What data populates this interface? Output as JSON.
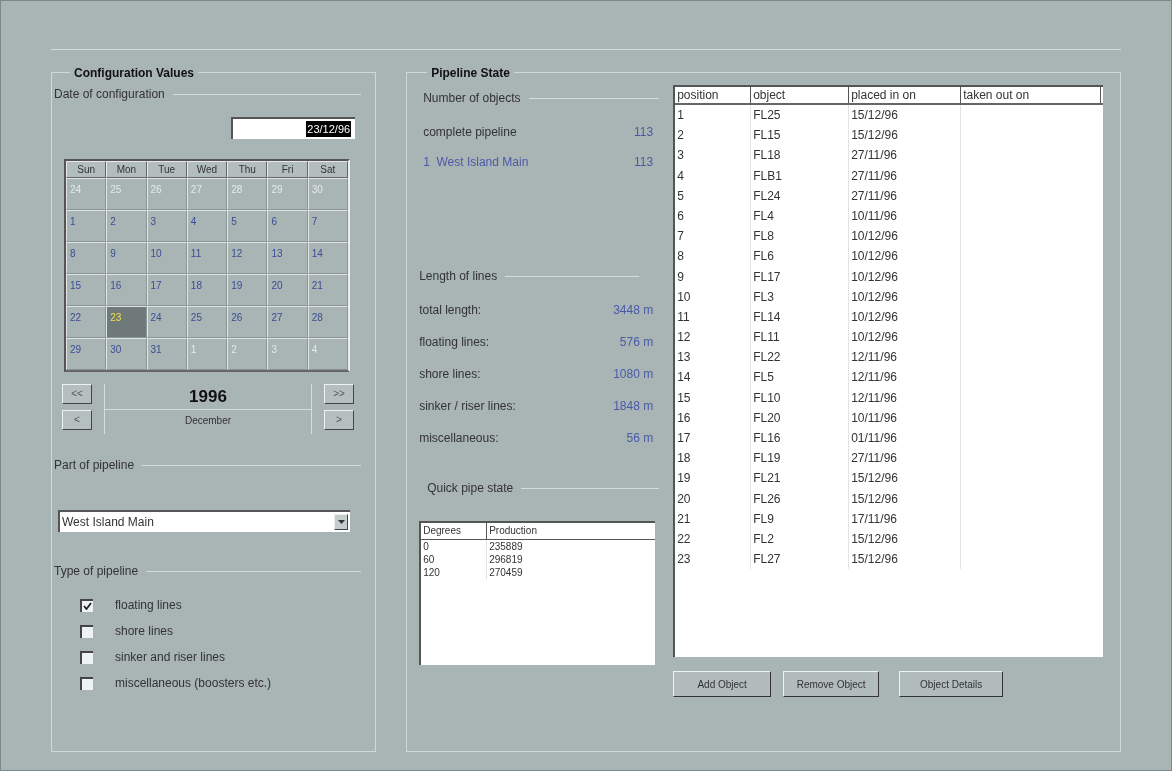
{
  "config": {
    "title": "Configuration Values",
    "date_section": {
      "title": "Date of configuration",
      "date_field": "23/12/96",
      "weekdays": [
        "Sun",
        "Mon",
        "Tue",
        "Wed",
        "Thu",
        "Fri",
        "Sat"
      ],
      "days": [
        {
          "label": "24",
          "kind": "other",
          "selected": false
        },
        {
          "label": "25",
          "kind": "other",
          "selected": false
        },
        {
          "label": "26",
          "kind": "other",
          "selected": false
        },
        {
          "label": "27",
          "kind": "other",
          "selected": false
        },
        {
          "label": "28",
          "kind": "other",
          "selected": false
        },
        {
          "label": "29",
          "kind": "other",
          "selected": false
        },
        {
          "label": "30",
          "kind": "other",
          "selected": false
        },
        {
          "label": "1",
          "kind": "month",
          "selected": false
        },
        {
          "label": "2",
          "kind": "month",
          "selected": false
        },
        {
          "label": "3",
          "kind": "month",
          "selected": false
        },
        {
          "label": "4",
          "kind": "month",
          "selected": false
        },
        {
          "label": "5",
          "kind": "month",
          "selected": false
        },
        {
          "label": "6",
          "kind": "month",
          "selected": false
        },
        {
          "label": "7",
          "kind": "month",
          "selected": false
        },
        {
          "label": "8",
          "kind": "month",
          "selected": false
        },
        {
          "label": "9",
          "kind": "month",
          "selected": false
        },
        {
          "label": "10",
          "kind": "month",
          "selected": false
        },
        {
          "label": "11",
          "kind": "month",
          "selected": false
        },
        {
          "label": "12",
          "kind": "month",
          "selected": false
        },
        {
          "label": "13",
          "kind": "month",
          "selected": false
        },
        {
          "label": "14",
          "kind": "month",
          "selected": false
        },
        {
          "label": "15",
          "kind": "month",
          "selected": false
        },
        {
          "label": "16",
          "kind": "month",
          "selected": false
        },
        {
          "label": "17",
          "kind": "month",
          "selected": false
        },
        {
          "label": "18",
          "kind": "month",
          "selected": false
        },
        {
          "label": "19",
          "kind": "month",
          "selected": false
        },
        {
          "label": "20",
          "kind": "month",
          "selected": false
        },
        {
          "label": "21",
          "kind": "month",
          "selected": false
        },
        {
          "label": "22",
          "kind": "month",
          "selected": false
        },
        {
          "label": "23",
          "kind": "month",
          "selected": true
        },
        {
          "label": "24",
          "kind": "month",
          "selected": false
        },
        {
          "label": "25",
          "kind": "month",
          "selected": false
        },
        {
          "label": "26",
          "kind": "month",
          "selected": false
        },
        {
          "label": "27",
          "kind": "month",
          "selected": false
        },
        {
          "label": "28",
          "kind": "month",
          "selected": false
        },
        {
          "label": "29",
          "kind": "month",
          "selected": false
        },
        {
          "label": "30",
          "kind": "month",
          "selected": false
        },
        {
          "label": "31",
          "kind": "month",
          "selected": false
        },
        {
          "label": "1",
          "kind": "other",
          "selected": false
        },
        {
          "label": "2",
          "kind": "other",
          "selected": false
        },
        {
          "label": "3",
          "kind": "other",
          "selected": false
        },
        {
          "label": "4",
          "kind": "other",
          "selected": false
        }
      ],
      "prev_year": "<<",
      "next_year": ">>",
      "prev_month": "<",
      "next_month": ">",
      "year": "1996",
      "month": "December"
    },
    "part_section": {
      "title": "Part of pipeline",
      "value": "West Island Main"
    },
    "type_section": {
      "title": "Type of pipeline",
      "options": [
        {
          "label": "floating lines",
          "checked": true
        },
        {
          "label": "shore lines",
          "checked": false
        },
        {
          "label": "sinker and riser lines",
          "checked": false
        },
        {
          "label": "miscellaneous (boosters etc.)",
          "checked": false
        }
      ]
    }
  },
  "state": {
    "title": "Pipeline State",
    "objects": {
      "title": "Number of objects",
      "rows": [
        {
          "label": "complete pipeline",
          "value": "113",
          "kind": "total"
        },
        {
          "label": "1  West Island Main",
          "value": "113",
          "kind": "part"
        }
      ]
    },
    "lengths": {
      "title": "Length of lines",
      "rows": [
        {
          "label": "total length:",
          "value": "3448 m"
        },
        {
          "label": "floating lines:",
          "value": "576 m"
        },
        {
          "label": "shore lines:",
          "value": "1080 m"
        },
        {
          "label": "sinker / riser lines:",
          "value": "1848 m"
        },
        {
          "label": "miscellaneous:",
          "value": "56 m"
        }
      ]
    },
    "quick": {
      "title": "Quick pipe state",
      "columns": [
        "Degrees",
        "Production"
      ],
      "rows": [
        [
          "0",
          "235889"
        ],
        [
          "60",
          "296819"
        ],
        [
          "120",
          "270459"
        ]
      ]
    },
    "table": {
      "columns": [
        "position",
        "object",
        "placed in on",
        "taken out on"
      ],
      "rows": [
        [
          "1",
          "FL25",
          "15/12/96"
        ],
        [
          "2",
          "FL15",
          "15/12/96"
        ],
        [
          "3",
          "FL18",
          "27/11/96"
        ],
        [
          "4",
          "FLB1",
          "27/11/96"
        ],
        [
          "5",
          "FL24",
          "27/11/96"
        ],
        [
          "6",
          "FL4",
          "10/11/96"
        ],
        [
          "7",
          "FL8",
          "10/12/96"
        ],
        [
          "8",
          "FL6",
          "10/12/96"
        ],
        [
          "9",
          "FL17",
          "10/12/96"
        ],
        [
          "10",
          "FL3",
          "10/12/96"
        ],
        [
          "11",
          "FL14",
          "10/12/96"
        ],
        [
          "12",
          "FL11",
          "10/12/96"
        ],
        [
          "13",
          "FL22",
          "12/11/96"
        ],
        [
          "14",
          "FL5",
          "12/11/96"
        ],
        [
          "15",
          "FL10",
          "12/11/96"
        ],
        [
          "16",
          "FL20",
          "10/11/96"
        ],
        [
          "17",
          "FL16",
          "01/11/96"
        ],
        [
          "18",
          "FL19",
          "27/11/96"
        ],
        [
          "19",
          "FL21",
          "15/12/96"
        ],
        [
          "20",
          "FL26",
          "15/12/96"
        ],
        [
          "21",
          "FL9",
          "17/11/96"
        ],
        [
          "22",
          "FL2",
          "15/12/96"
        ],
        [
          "23",
          "FL27",
          "15/12/96"
        ]
      ]
    },
    "buttons": [
      "Add Object",
      "Remove Object",
      "Object Details"
    ]
  }
}
